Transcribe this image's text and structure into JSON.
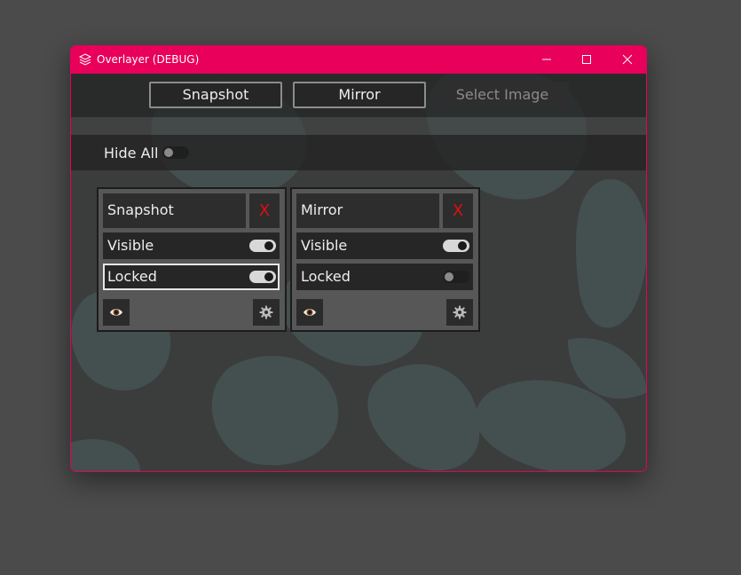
{
  "window": {
    "title": "Overlayer (DEBUG)",
    "accent": "#e8005a"
  },
  "toolbar": {
    "snapshot_label": "Snapshot",
    "mirror_label": "Mirror",
    "select_image_label": "Select Image"
  },
  "hide_all": {
    "label": "Hide All",
    "on": false
  },
  "layers": [
    {
      "name": "Snapshot",
      "close_label": "X",
      "visible_label": "Visible",
      "visible_on": true,
      "locked_label": "Locked",
      "locked_on": true,
      "eye_icon": "eye-icon",
      "settings_icon": "gear-icon"
    },
    {
      "name": "Mirror",
      "close_label": "X",
      "visible_label": "Visible",
      "visible_on": true,
      "locked_label": "Locked",
      "locked_on": false,
      "eye_icon": "eye-icon",
      "settings_icon": "gear-icon"
    }
  ]
}
